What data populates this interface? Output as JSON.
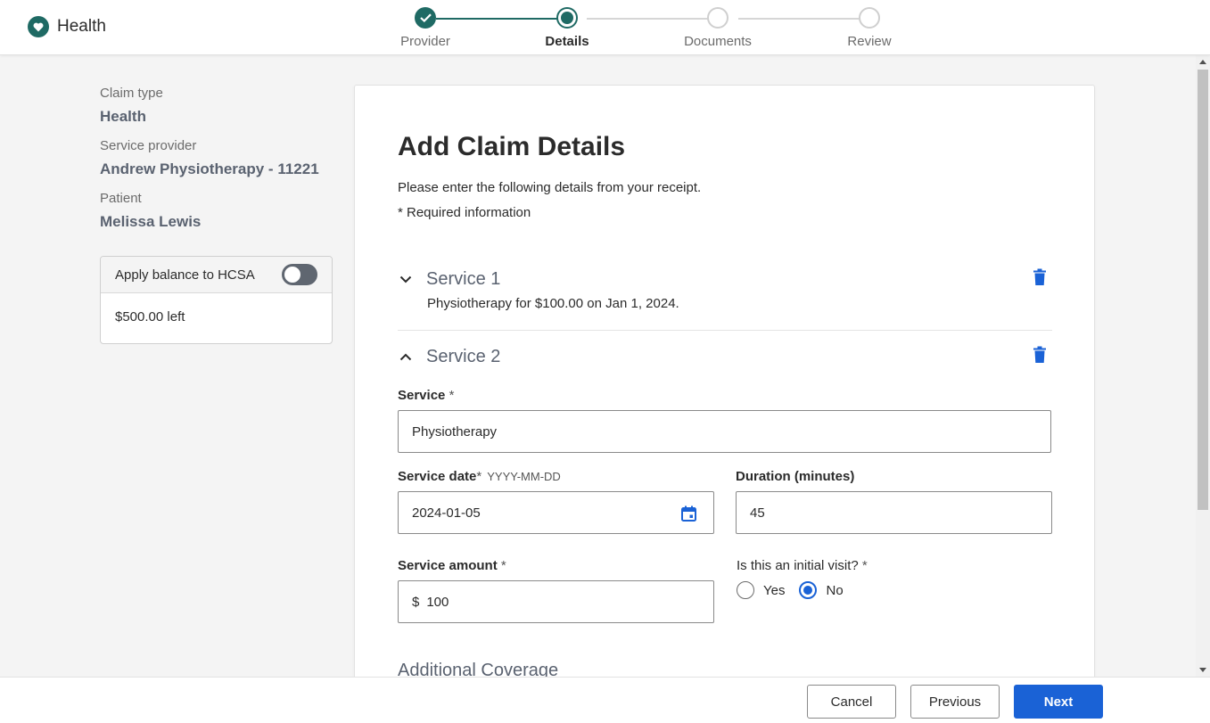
{
  "header": {
    "brand": "Health",
    "steps": [
      {
        "label": "Provider",
        "state": "done"
      },
      {
        "label": "Details",
        "state": "current"
      },
      {
        "label": "Documents",
        "state": "todo"
      },
      {
        "label": "Review",
        "state": "todo"
      }
    ]
  },
  "summary": {
    "claim_type_label": "Claim type",
    "claim_type_value": "Health",
    "provider_label": "Service provider",
    "provider_value": "Andrew Physiotherapy - 11221",
    "patient_label": "Patient",
    "patient_value": "Melissa Lewis",
    "hcsa": {
      "title": "Apply balance to HCSA",
      "toggle_on": false,
      "balance": "$500.00 left"
    }
  },
  "form": {
    "title": "Add Claim Details",
    "subtitle": "Please enter the following details from your receipt.",
    "required_note": "* Required information",
    "services": [
      {
        "title": "Service 1",
        "expanded": false,
        "summary": "Physiotherapy for $100.00 on Jan 1, 2024."
      },
      {
        "title": "Service 2",
        "expanded": true
      }
    ],
    "service_label": "Service",
    "service_value": "Physiotherapy",
    "date_label": "Service date",
    "date_hint": "YYYY-MM-DD",
    "date_value": "2024-01-05",
    "duration_label": "Duration (minutes)",
    "duration_value": "45",
    "amount_label": "Service amount",
    "amount_currency": "$",
    "amount_value": "100",
    "initial_visit_question": "Is this an initial visit?",
    "initial_visit_options": [
      "Yes",
      "No"
    ],
    "initial_visit_selected": "No",
    "required_mark": "*",
    "additional_coverage": "Additional Coverage"
  },
  "footer": {
    "cancel": "Cancel",
    "previous": "Previous",
    "next": "Next"
  },
  "colors": {
    "brand": "#1f6a64",
    "primary": "#1a62d6"
  }
}
